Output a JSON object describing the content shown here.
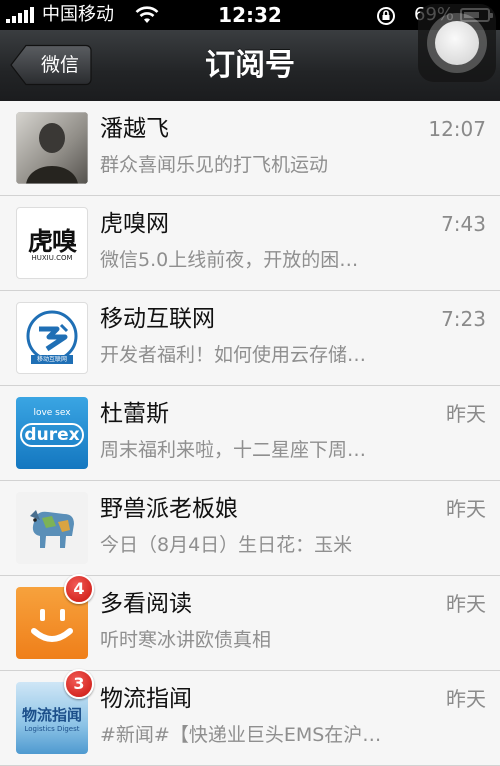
{
  "status_bar": {
    "carrier": "中国移动",
    "time": "12:32",
    "battery_percent": "69%",
    "battery_level": 0.69
  },
  "nav": {
    "back_label": "微信",
    "title": "订阅号"
  },
  "subscriptions": [
    {
      "name": "潘越飞",
      "time": "12:07",
      "preview": "群众喜闻乐见的打飞机运动",
      "avatar_icon": "portrait-photo"
    },
    {
      "name": "虎嗅网",
      "time": "7:43",
      "preview": "微信5.0上线前夜，开放的困…",
      "avatar_icon": "huxiu-logo",
      "avatar_text": "虎嗅",
      "avatar_subtext": "HUXIU.COM"
    },
    {
      "name": "移动互联网",
      "time": "7:23",
      "preview": "开发者福利！如何使用云存储…",
      "avatar_icon": "mobile-internet-logo",
      "avatar_text": "移动互联网"
    },
    {
      "name": "杜蕾斯",
      "time": "昨天",
      "preview": "周末福利来啦，十二星座下周…",
      "avatar_icon": "durex-logo",
      "avatar_text": "durex",
      "avatar_subtext": "love sex"
    },
    {
      "name": "野兽派老板娘",
      "time": "昨天",
      "preview": "今日（8月4日）生日花：玉米",
      "avatar_icon": "toy-dog-photo"
    },
    {
      "name": "多看阅读",
      "time": "昨天",
      "preview": "听时寒冰讲欧债真相",
      "avatar_icon": "duokan-logo",
      "badge": "4"
    },
    {
      "name": "物流指闻",
      "time": "昨天",
      "preview": "#新闻#【快递业巨头EMS在沪…",
      "avatar_icon": "logistics-digest-logo",
      "avatar_text": "物流指闻",
      "avatar_subtext": "Logistics Digest",
      "badge": "3"
    }
  ]
}
